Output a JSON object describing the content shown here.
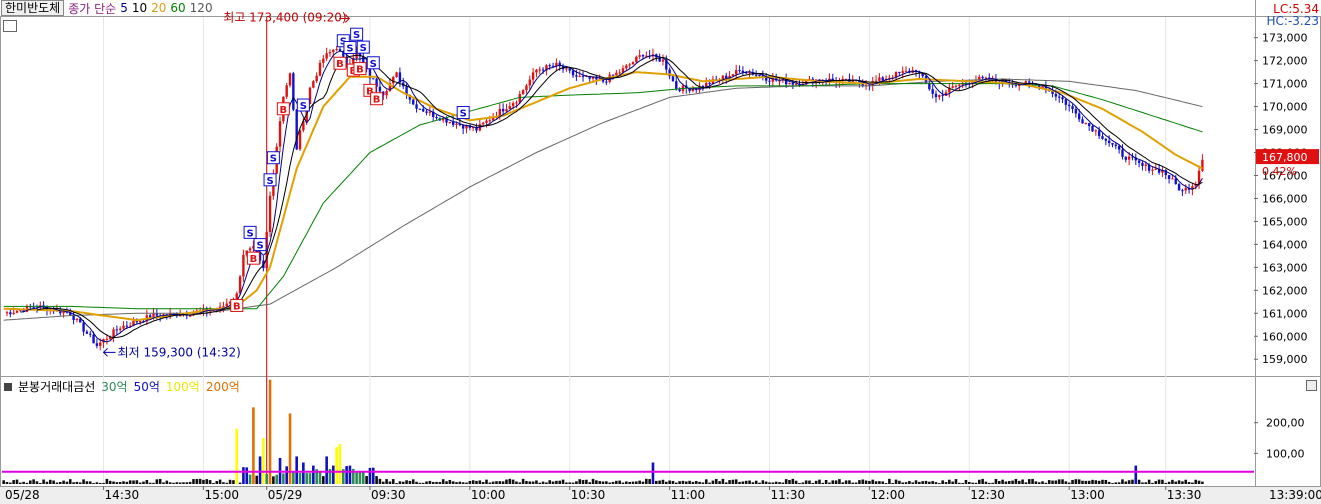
{
  "header": {
    "stock_name": "한미반도체",
    "indicator": "종가 단순",
    "ma_periods": [
      "5",
      "10",
      "20",
      "60",
      "120"
    ]
  },
  "limits": {
    "lc": "LC:5.34",
    "hc": "HC:-3.23"
  },
  "price_badge": {
    "price": "167,800",
    "change": "0.42%"
  },
  "annotations": {
    "high": "최고 173,400 (09:20)",
    "low": "최저 159,300 (14:32)"
  },
  "volume_header": {
    "title": "분봉거래대금선",
    "levels": [
      "30억",
      "50억",
      "100억",
      "200억"
    ]
  },
  "colors": {
    "up": "#e01010",
    "down": "#1010d0",
    "ma5": "#000080",
    "ma10": "#000000",
    "ma20": "#e0a000",
    "ma60": "#008000",
    "ma120": "#666666",
    "vol_30": "#2e8b57",
    "vol_50": "#1010c0",
    "vol_100": "#ffff00",
    "vol_200": "#e07000",
    "threshold_line": "#e000e0",
    "day_divider": "#d00000"
  },
  "chart_data": {
    "type": "candlestick",
    "price_axis": {
      "ticks": [
        159000,
        160000,
        161000,
        162000,
        163000,
        164000,
        165000,
        166000,
        167000,
        168000,
        169000,
        170000,
        171000,
        172000,
        173000
      ],
      "tick_labels": [
        "159,000",
        "160,000",
        "161,000",
        "162,000",
        "163,000",
        "164,000",
        "165,000",
        "166,000",
        "167,000",
        "168,000",
        "169,000",
        "170,000",
        "171,000",
        "172,000",
        "173,000"
      ],
      "range": [
        158400,
        173900
      ]
    },
    "volume_axis": {
      "ticks": [
        100,
        200
      ],
      "tick_labels": [
        "100,00",
        "200,00"
      ],
      "range": [
        0,
        300
      ]
    },
    "time_axis": {
      "labels": [
        "05/28",
        "14:30",
        "15:00",
        "05/29",
        "09:30",
        "10:00",
        "10:30",
        "11:00",
        "11:30",
        "12:00",
        "12:30",
        "13:00",
        "13:30",
        "13:39:00"
      ],
      "label_bars": [
        0,
        30,
        60,
        79,
        110,
        140,
        170,
        200,
        230,
        260,
        290,
        320,
        349,
        373
      ]
    },
    "day_divider_bar": 79,
    "close_keypoints": [
      [
        0,
        161000
      ],
      [
        10,
        161300
      ],
      [
        20,
        161000
      ],
      [
        28,
        159600
      ],
      [
        35,
        160400
      ],
      [
        45,
        160900
      ],
      [
        55,
        161000
      ],
      [
        65,
        161200
      ],
      [
        70,
        161800
      ],
      [
        72,
        163600
      ],
      [
        75,
        163800
      ],
      [
        78,
        162900
      ],
      [
        80,
        166100
      ],
      [
        84,
        170500
      ],
      [
        86,
        171400
      ],
      [
        88,
        168200
      ],
      [
        92,
        170800
      ],
      [
        96,
        172100
      ],
      [
        100,
        172600
      ],
      [
        103,
        171800
      ],
      [
        106,
        172400
      ],
      [
        110,
        171300
      ],
      [
        114,
        170600
      ],
      [
        118,
        171400
      ],
      [
        123,
        170100
      ],
      [
        128,
        169700
      ],
      [
        135,
        169300
      ],
      [
        142,
        169000
      ],
      [
        148,
        169700
      ],
      [
        154,
        170300
      ],
      [
        160,
        171600
      ],
      [
        166,
        171800
      ],
      [
        172,
        171300
      ],
      [
        180,
        171100
      ],
      [
        186,
        171600
      ],
      [
        192,
        172300
      ],
      [
        198,
        172000
      ],
      [
        202,
        170800
      ],
      [
        208,
        170800
      ],
      [
        215,
        171200
      ],
      [
        222,
        171600
      ],
      [
        230,
        171200
      ],
      [
        238,
        171000
      ],
      [
        245,
        171200
      ],
      [
        252,
        171100
      ],
      [
        260,
        171000
      ],
      [
        268,
        171400
      ],
      [
        274,
        171600
      ],
      [
        280,
        170400
      ],
      [
        286,
        170900
      ],
      [
        292,
        171200
      ],
      [
        298,
        171100
      ],
      [
        305,
        171000
      ],
      [
        312,
        170900
      ],
      [
        318,
        170300
      ],
      [
        324,
        169400
      ],
      [
        330,
        168700
      ],
      [
        336,
        167900
      ],
      [
        342,
        167400
      ],
      [
        348,
        167200
      ],
      [
        354,
        166300
      ],
      [
        358,
        166700
      ],
      [
        360,
        167800
      ]
    ],
    "ma20_keypoints": [
      [
        0,
        161200
      ],
      [
        20,
        161100
      ],
      [
        40,
        160700
      ],
      [
        60,
        161100
      ],
      [
        70,
        161300
      ],
      [
        76,
        162000
      ],
      [
        80,
        163000
      ],
      [
        88,
        167300
      ],
      [
        96,
        170000
      ],
      [
        104,
        171300
      ],
      [
        112,
        171300
      ],
      [
        120,
        170600
      ],
      [
        130,
        169900
      ],
      [
        140,
        169400
      ],
      [
        150,
        169600
      ],
      [
        160,
        170200
      ],
      [
        170,
        170800
      ],
      [
        180,
        171200
      ],
      [
        190,
        171500
      ],
      [
        200,
        171400
      ],
      [
        210,
        171100
      ],
      [
        220,
        171200
      ],
      [
        230,
        171300
      ],
      [
        245,
        171100
      ],
      [
        260,
        171000
      ],
      [
        275,
        171200
      ],
      [
        290,
        171100
      ],
      [
        305,
        171000
      ],
      [
        318,
        170600
      ],
      [
        330,
        169900
      ],
      [
        342,
        168900
      ],
      [
        352,
        167900
      ],
      [
        360,
        167300
      ]
    ],
    "ma60_keypoints": [
      [
        0,
        161300
      ],
      [
        20,
        161300
      ],
      [
        40,
        161200
      ],
      [
        60,
        161200
      ],
      [
        76,
        161200
      ],
      [
        84,
        162600
      ],
      [
        96,
        165800
      ],
      [
        110,
        168000
      ],
      [
        125,
        169200
      ],
      [
        140,
        169800
      ],
      [
        155,
        170400
      ],
      [
        170,
        170500
      ],
      [
        190,
        170600
      ],
      [
        205,
        170800
      ],
      [
        220,
        170900
      ],
      [
        240,
        170900
      ],
      [
        260,
        171000
      ],
      [
        280,
        171000
      ],
      [
        300,
        171000
      ],
      [
        315,
        170900
      ],
      [
        330,
        170300
      ],
      [
        345,
        169600
      ],
      [
        360,
        168900
      ]
    ],
    "ma120_keypoints": [
      [
        0,
        160700
      ],
      [
        20,
        160900
      ],
      [
        40,
        161000
      ],
      [
        60,
        161000
      ],
      [
        80,
        161400
      ],
      [
        100,
        163000
      ],
      [
        120,
        164800
      ],
      [
        140,
        166500
      ],
      [
        160,
        168000
      ],
      [
        180,
        169300
      ],
      [
        200,
        170400
      ],
      [
        220,
        170800
      ],
      [
        240,
        170900
      ],
      [
        260,
        170900
      ],
      [
        280,
        171100
      ],
      [
        300,
        171200
      ],
      [
        320,
        171100
      ],
      [
        340,
        170700
      ],
      [
        360,
        170000
      ]
    ],
    "vol_spikes": [
      [
        70,
        180
      ],
      [
        75,
        250
      ],
      [
        77,
        90
      ],
      [
        78,
        150
      ],
      [
        80,
        340
      ],
      [
        83,
        85
      ],
      [
        86,
        230
      ],
      [
        88,
        90
      ],
      [
        90,
        70
      ],
      [
        93,
        60
      ],
      [
        97,
        90
      ],
      [
        99,
        60
      ],
      [
        100,
        120
      ],
      [
        101,
        130
      ],
      [
        104,
        60
      ],
      [
        108,
        40
      ],
      [
        195,
        70
      ],
      [
        340,
        60
      ]
    ],
    "vol_threshold": 40,
    "signals": [
      {
        "bar": 70,
        "type": "B"
      },
      {
        "bar": 74,
        "type": "S"
      },
      {
        "bar": 75,
        "type": "B"
      },
      {
        "bar": 77,
        "type": "S"
      },
      {
        "bar": 80,
        "type": "S"
      },
      {
        "bar": 81,
        "type": "S"
      },
      {
        "bar": 84,
        "type": "B"
      },
      {
        "bar": 90,
        "type": "S"
      },
      {
        "bar": 101,
        "type": "B"
      },
      {
        "bar": 102,
        "type": "S"
      },
      {
        "bar": 104,
        "type": "S"
      },
      {
        "bar": 105,
        "type": "B"
      },
      {
        "bar": 106,
        "type": "S"
      },
      {
        "bar": 107,
        "type": "B"
      },
      {
        "bar": 108,
        "type": "S"
      },
      {
        "bar": 110,
        "type": "B"
      },
      {
        "bar": 111,
        "type": "S"
      },
      {
        "bar": 112,
        "type": "B"
      },
      {
        "bar": 138,
        "type": "S"
      }
    ],
    "high_bar": 105,
    "low_bar": 30
  }
}
